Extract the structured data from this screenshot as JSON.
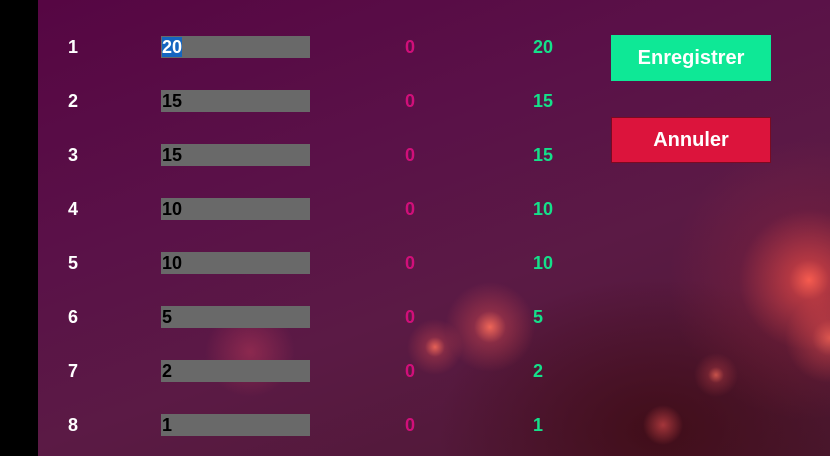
{
  "rows": [
    {
      "rank": "1",
      "score": "20",
      "penalty": "0",
      "total": "20"
    },
    {
      "rank": "2",
      "score": "15",
      "penalty": "0",
      "total": "15"
    },
    {
      "rank": "3",
      "score": "15",
      "penalty": "0",
      "total": "15"
    },
    {
      "rank": "4",
      "score": "10",
      "penalty": "0",
      "total": "10"
    },
    {
      "rank": "5",
      "score": "10",
      "penalty": "0",
      "total": "10"
    },
    {
      "rank": "6",
      "score": "5",
      "penalty": "0",
      "total": "5"
    },
    {
      "rank": "7",
      "score": "2",
      "penalty": "0",
      "total": "2"
    },
    {
      "rank": "8",
      "score": "1",
      "penalty": "0",
      "total": "1"
    }
  ],
  "actions": {
    "save_label": "Enregistrer",
    "cancel_label": "Annuler"
  },
  "colors": {
    "save": "#0ee896",
    "cancel": "#dc143c",
    "penalty_text": "#d10f7a",
    "total_text": "#15e08a",
    "input_bg": "#696969",
    "selection": "#1565c0"
  }
}
